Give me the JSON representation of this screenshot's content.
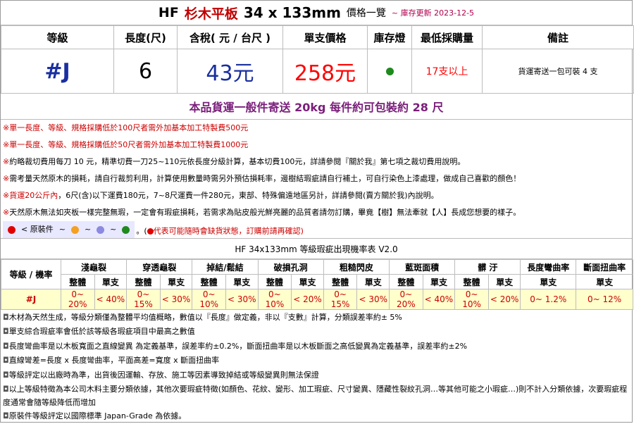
{
  "title": {
    "brand": "HF",
    "name": "杉木平板",
    "size": "34 x 133mm",
    "price_list": "價格一覽",
    "stock_update": "~ 庫存更新 2023-12-5"
  },
  "product": {
    "headers": [
      "等級",
      "長度(尺)",
      "含稅( 元 / 台尺 )",
      "單支價格",
      "庫存燈",
      "最低採購量",
      "備註"
    ],
    "grade": "#J",
    "length": "6",
    "price_per_tai_chi": "43元",
    "unit_price": "258元",
    "stock_light_color": "#1e8a1e",
    "min_order": "17支以上",
    "remark": "貨運寄送一包可裝 4 支"
  },
  "shipping_banner": "本品貨運一般件寄送 20kg 每件約可包裝約 28 尺",
  "notes": [
    {
      "mark": "※",
      "text": "單一長度、等級、規格採購低於100尺者需外加基本加工特製費500元",
      "red": true
    },
    {
      "mark": "※",
      "text": "單一長度、等級、規格採購低於50尺者需外加基本加工特製費1000元",
      "red": true
    },
    {
      "mark": "※",
      "text": "約略裁切費用每刀 10 元，精準切費一刀25~110元依長度分級計算，基本切費100元，詳請參閱『關於我』第七項之裁切費用說明。",
      "red": false
    },
    {
      "mark": "※",
      "text": "需考量天然原木的損耗，請自行裁剪利用，計算使用數量時需另外預估損耗率，邊樹結瑕疵請自行補土，可自行染色上漆處理，做成自己喜歡的顏色！",
      "red": false
    },
    {
      "mark": "※",
      "text_red": "貨運20公斤內",
      "text": "，6尺(含)以下運費180元，7~8尺運費一件280元，東部、特殊偏遠地區另計，詳請參閱(賣方關於我)內說明。",
      "red": false
    },
    {
      "mark": "※",
      "text": "天然原木無法如夾板一樣完整無瑕，一定會有瑕疵損耗，若需求為貼皮般光鮮亮麗的品質者請勿訂購，畢竟【樹】無法牽就【人】長成您想要的樣子。",
      "red": false
    }
  ],
  "legend": {
    "prefix": "< 原裝件",
    "sep": "~",
    "colors": [
      "#e00000",
      "#f4a020",
      "#8a8ae0",
      "#1e8a1e"
    ],
    "suffix": "。(",
    "warning": "代表可能隨時會缺貨狀態，訂購前請再確認)"
  },
  "defects": {
    "title": "HF 34x133mm 等級瑕疵出現機率表 V2.0",
    "row_header": "等級 / 機率",
    "whole": "整體",
    "single": "單支",
    "categories": [
      "淺龜裂",
      "穿透龜裂",
      "掉結/鬆結",
      "破損孔洞",
      "粗糙閃皮",
      "藍斑面積",
      "髒 汙"
    ],
    "extra_categories": [
      "長度彎曲率",
      "斷面扭曲率"
    ],
    "grade": "#J",
    "values": [
      "0~ 20%",
      "< 40%",
      "0~ 15%",
      "< 30%",
      "0~ 10%",
      "< 30%",
      "0~ 10%",
      "< 20%",
      "0~ 15%",
      "< 30%",
      "0~ 20%",
      "< 40%",
      "0~ 10%",
      "< 20%"
    ],
    "extra_values": [
      "0~ 1.2%",
      "0~ 12%"
    ]
  },
  "defect_notes": [
    "木材為天然生成，等級分類僅為整體平均值概略，數值以『長度』做定義，非以『支數』計算，分類誤差率約± 5%",
    "單支綜合瑕疵率會低於該等級各瑕疵項目中最高之數值",
    "長度彎曲率是以木板寬面之直線變異 為定義基準，誤差率約±0.2%，斷面扭曲率是以木板斷面之高低變異為定義基準，誤差率約±2%",
    "直線彎差=長度 x 長度彎曲率，平面高差=寬度 x 斷面扭曲率",
    "等級評定以出廠時為準，出貨後因運輸、存放、施工等因素導致掉結或等級變異則無法保證",
    "以上等級特徵為本公司木料主要分類依據，其他次要瑕疵特徵(如顏色、花紋、變形、加工瑕疵、尺寸變異、隱藏性裂紋孔洞…等其他可能之小瑕疵…)則不計入分類依據，次要瑕疵程度通常會隨等級降低而增加",
    "原裝件等級評定以國際標準 Japan-Grade 為依據。"
  ]
}
